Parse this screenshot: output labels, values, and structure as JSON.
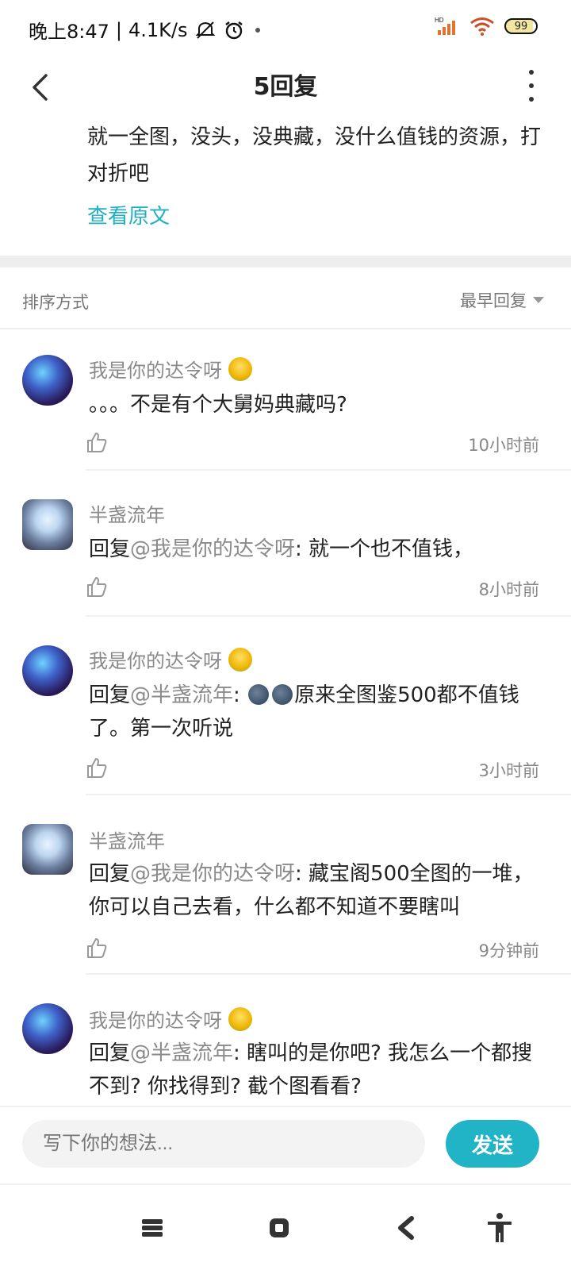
{
  "status_bar": {
    "time": "晚上8:47",
    "net_speed": "4.1K/s",
    "battery": "99",
    "signal_label": "HD"
  },
  "header": {
    "title": "5回复"
  },
  "original_post": {
    "text": "就一全图，没头，没典藏，没什么值钱的资源，打对折吧",
    "view_original": "查看原文"
  },
  "sort": {
    "label": "排序方式",
    "value": "最早回复"
  },
  "comments": [
    {
      "user": "我是你的达令呀",
      "text": "。。。不是有个大舅妈典藏吗?",
      "time": "10小时前",
      "avatar": "a",
      "badge": true
    },
    {
      "user": "半盏流年",
      "reply_prefix": "回复",
      "mention": "@我是你的达令呀",
      "text": ": 就一个也不值钱，",
      "time": "8小时前",
      "avatar": "b",
      "badge": false
    },
    {
      "user": "我是你的达令呀",
      "reply_prefix": "回复",
      "mention": "@半盏流年",
      "text": "原来全图鉴500都不值钱了。第一次听说",
      "time": "3小时前",
      "avatar": "a",
      "badge": true
    },
    {
      "user": "半盏流年",
      "reply_prefix": "回复",
      "mention": "@我是你的达令呀",
      "text": ": 藏宝阁500全图的一堆，你可以自己去看，什么都不知道不要瞎叫",
      "time": "9分钟前",
      "avatar": "b",
      "badge": false
    },
    {
      "user": "我是你的达令呀",
      "reply_prefix": "回复",
      "mention": "@半盏流年",
      "text": ": 瞎叫的是你吧? 我怎么一个都搜不到? 你找得到? 截个图看看?",
      "avatar": "a",
      "badge": true
    }
  ],
  "input": {
    "placeholder": "写下你的想法...",
    "send_label": "发送"
  },
  "colors": {
    "accent": "#21b3c6",
    "link": "#1fb0c4",
    "muted": "#8a8a8a"
  },
  "icons": {
    "back": "chevron-left-icon",
    "more": "more-vertical-icon",
    "like": "thumbs-up-icon",
    "nav": [
      "menu-icon",
      "home-icon",
      "back-icon",
      "accessibility-icon"
    ]
  }
}
